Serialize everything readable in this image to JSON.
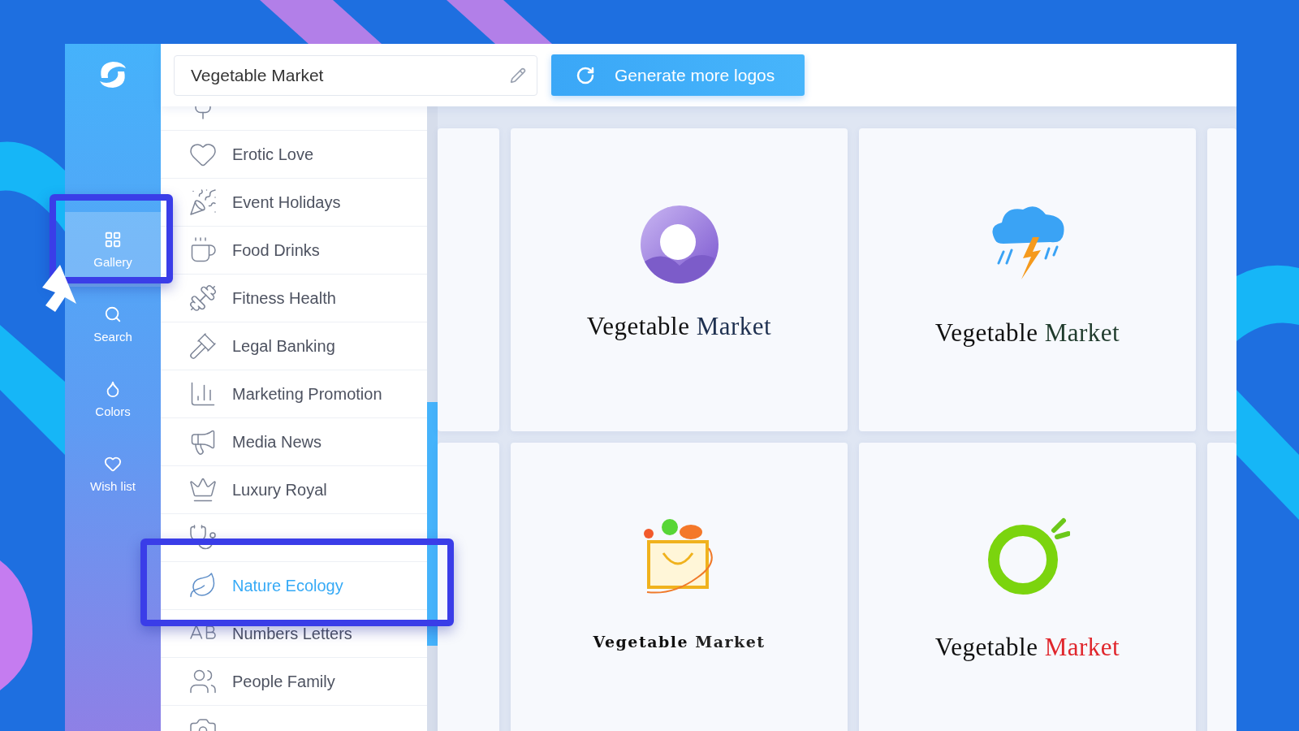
{
  "sidebar": {
    "items": [
      {
        "label": "Gallery",
        "selected": true
      },
      {
        "label": "Search",
        "selected": false
      },
      {
        "label": "Colors",
        "selected": false
      },
      {
        "label": "Wish list",
        "selected": false
      }
    ]
  },
  "top_bar": {
    "name_field": {
      "value": "Vegetable Market"
    },
    "generate_button": "Generate more logos"
  },
  "categories": [
    {
      "selected": false
    },
    {
      "label": "Erotic Love",
      "selected": false
    },
    {
      "label": "Event Holidays",
      "selected": false
    },
    {
      "label": "Food Drinks",
      "selected": false
    },
    {
      "label": "Fitness Health",
      "selected": false
    },
    {
      "label": "Legal Banking",
      "selected": false
    },
    {
      "label": "Marketing Promotion",
      "selected": false
    },
    {
      "label": "Media News",
      "selected": false
    },
    {
      "label": "Luxury Royal",
      "selected": false
    },
    {
      "selected": false
    },
    {
      "label": "Nature Ecology",
      "selected": true
    },
    {
      "label": "Numbers Letters",
      "selected": false
    },
    {
      "label": "People Family",
      "selected": false
    },
    {
      "selected": false
    }
  ],
  "logos": [
    {
      "kind": "ring",
      "words": [
        "Vegetable",
        "Market"
      ],
      "color": "#1e3050"
    },
    {
      "kind": "storm",
      "words": [
        "Vegetable",
        "Market"
      ],
      "color": "#1f3b2c"
    },
    {
      "kind": "basket",
      "words": [
        "Vegetable",
        "Market"
      ],
      "color": "#222222"
    },
    {
      "kind": "brush",
      "words": [
        "Vegetable",
        "Market"
      ],
      "color": "#e0262c"
    }
  ]
}
